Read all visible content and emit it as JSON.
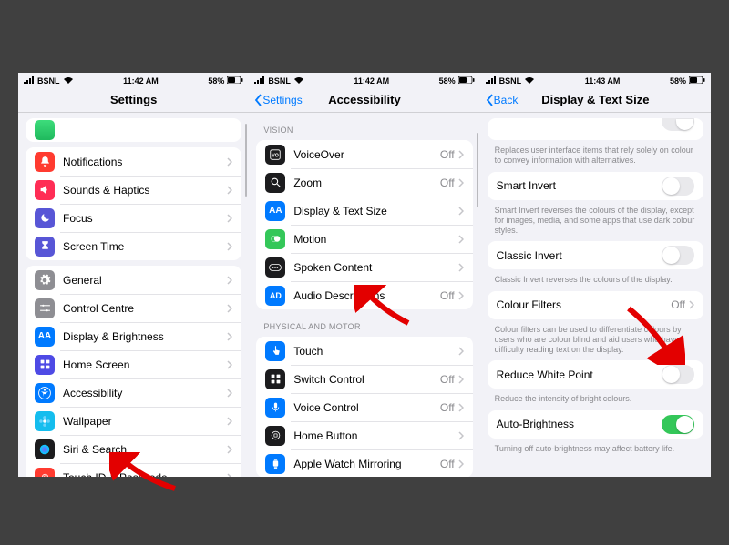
{
  "statusbar": {
    "carrier": "BSNL",
    "time1": "11:42 AM",
    "time2": "11:42 AM",
    "time3": "11:43 AM",
    "battery": "58%"
  },
  "phone1": {
    "title": "Settings",
    "groups": [
      [
        {
          "icon": "bell",
          "color": "#ff3b30",
          "label": "Notifications"
        },
        {
          "icon": "speaker",
          "color": "#ff2d55",
          "label": "Sounds & Haptics"
        },
        {
          "icon": "moon",
          "color": "#5856d6",
          "label": "Focus"
        },
        {
          "icon": "hourglass",
          "color": "#5856d6",
          "label": "Screen Time"
        }
      ],
      [
        {
          "icon": "gear",
          "color": "#8e8e93",
          "label": "General"
        },
        {
          "icon": "sliders",
          "color": "#8e8e93",
          "label": "Control Centre"
        },
        {
          "icon": "aa",
          "color": "#007aff",
          "label": "Display & Brightness"
        },
        {
          "icon": "grid",
          "color": "#4e4ae5",
          "label": "Home Screen"
        },
        {
          "icon": "accessibility",
          "color": "#007aff",
          "label": "Accessibility"
        },
        {
          "icon": "flower",
          "color": "#14bdee",
          "label": "Wallpaper"
        },
        {
          "icon": "siri",
          "color": "#1c1c1e",
          "label": "Siri & Search"
        },
        {
          "icon": "fingerprint",
          "color": "#ff3b30",
          "label": "Touch ID & Passcode"
        }
      ]
    ]
  },
  "phone2": {
    "back": "Settings",
    "title": "Accessibility",
    "section1_header": "VISION",
    "section1": [
      {
        "icon": "vo",
        "color": "#1c1c1e",
        "label": "VoiceOver",
        "value": "Off"
      },
      {
        "icon": "zoom",
        "color": "#1c1c1e",
        "label": "Zoom",
        "value": "Off"
      },
      {
        "icon": "aa",
        "color": "#007aff",
        "label": "Display & Text Size"
      },
      {
        "icon": "motion",
        "color": "#34c759",
        "label": "Motion"
      },
      {
        "icon": "ellipsis",
        "color": "#1c1c1e",
        "label": "Spoken Content"
      },
      {
        "icon": "ad",
        "color": "#007aff",
        "label": "Audio Descriptions",
        "value": "Off"
      }
    ],
    "section2_header": "PHYSICAL AND MOTOR",
    "section2": [
      {
        "icon": "touch",
        "color": "#007aff",
        "label": "Touch"
      },
      {
        "icon": "switch",
        "color": "#1c1c1e",
        "label": "Switch Control",
        "value": "Off"
      },
      {
        "icon": "mic",
        "color": "#007aff",
        "label": "Voice Control",
        "value": "Off"
      },
      {
        "icon": "homebtn",
        "color": "#1c1c1e",
        "label": "Home Button"
      },
      {
        "icon": "watch",
        "color": "#007aff",
        "label": "Apple Watch Mirroring",
        "value": "Off"
      }
    ]
  },
  "phone3": {
    "back": "Back",
    "title": "Display & Text Size",
    "top_footer": "Replaces user interface items that rely solely on colour to convey information with alternatives.",
    "rows": [
      {
        "label": "Smart Invert",
        "type": "toggle",
        "on": false,
        "footer": "Smart Invert reverses the colours of the display, except for images, media, and some apps that use dark colour styles."
      },
      {
        "label": "Classic Invert",
        "type": "toggle",
        "on": false,
        "footer": "Classic Invert reverses the colours of the display."
      },
      {
        "label": "Colour Filters",
        "type": "link",
        "value": "Off",
        "footer": "Colour filters can be used to differentiate colours by users who are colour blind and aid users who have difficulty reading text on the display."
      },
      {
        "label": "Reduce White Point",
        "type": "toggle",
        "on": false,
        "footer": "Reduce the intensity of bright colours."
      },
      {
        "label": "Auto-Brightness",
        "type": "toggle",
        "on": true,
        "footer": "Turning off auto-brightness may affect battery life."
      }
    ]
  }
}
